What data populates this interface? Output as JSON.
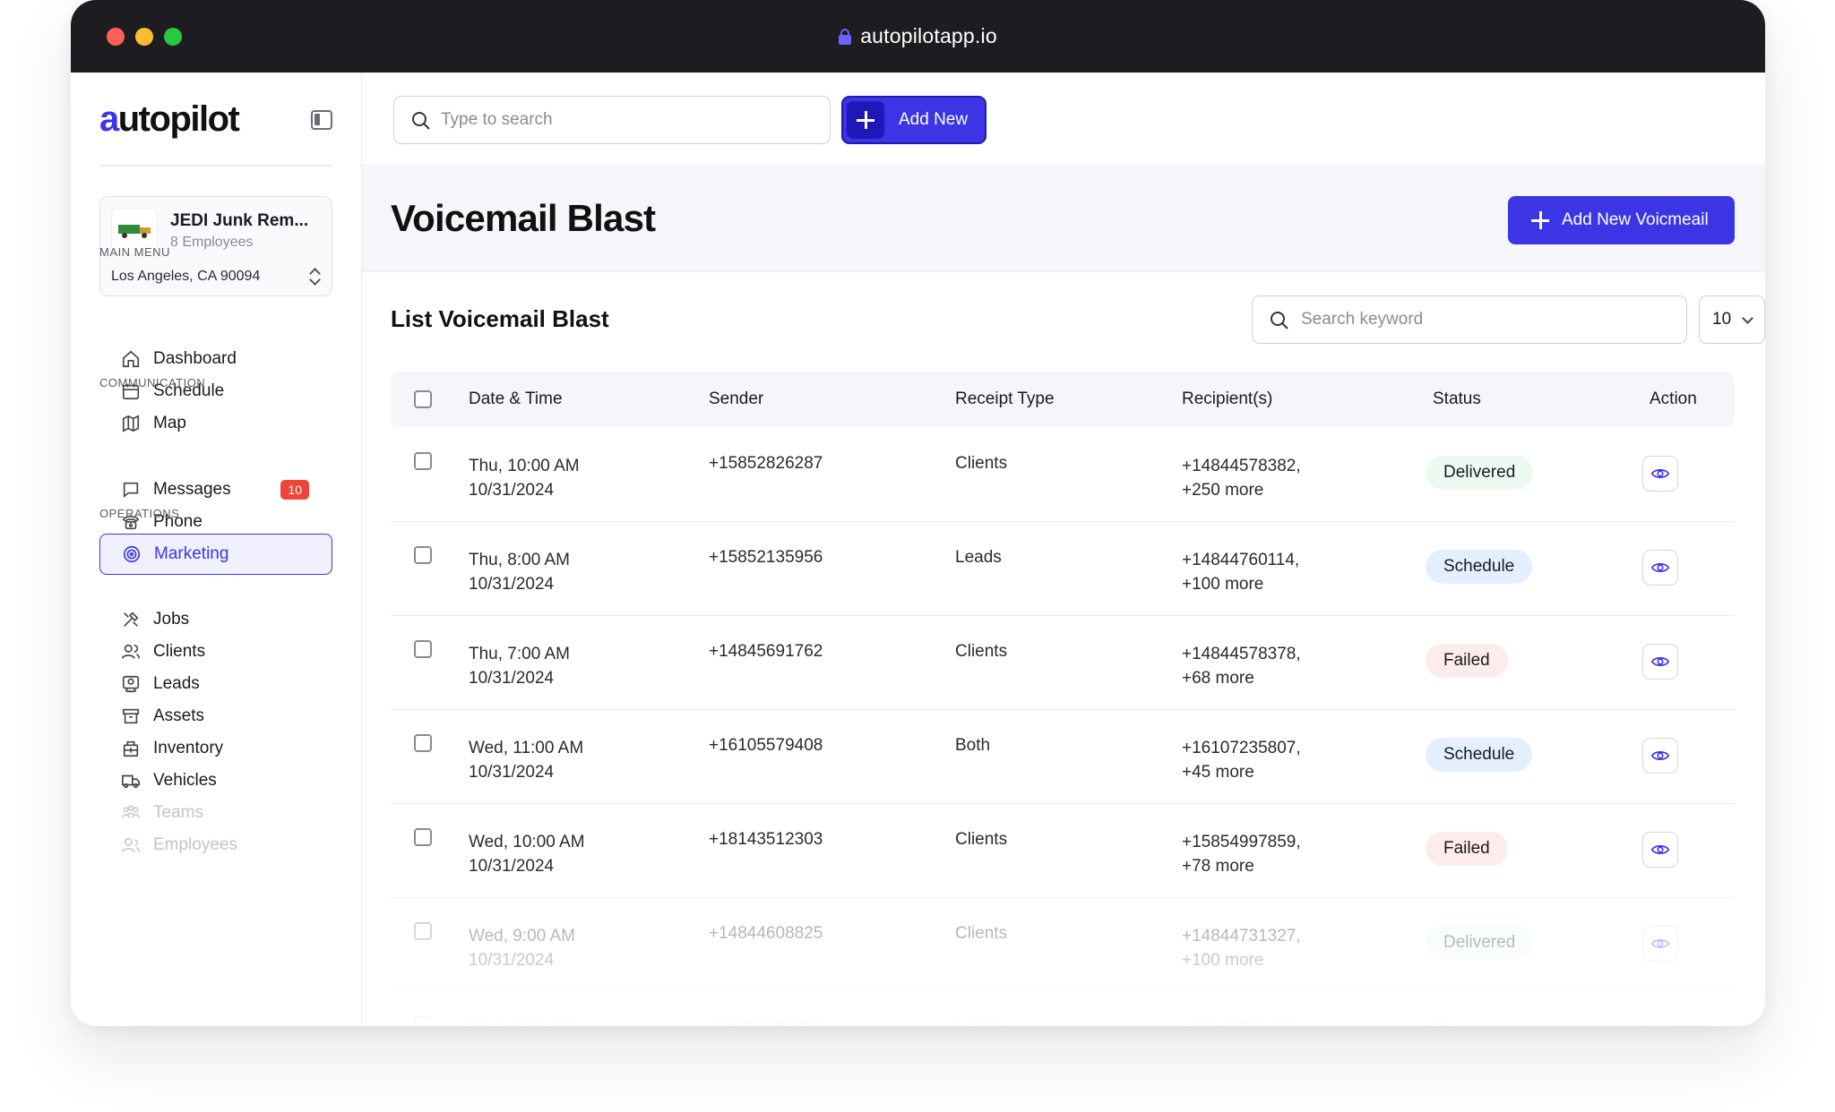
{
  "browser": {
    "url": "autopilotapp.io"
  },
  "logo": {
    "text_a": "a",
    "text_rest": "utopilot"
  },
  "company": {
    "name": "JEDI Junk Rem...",
    "employees": "8 Employees",
    "location": "Los Angeles, CA 90094"
  },
  "sidebar": {
    "sections": {
      "main": "MAIN MENU",
      "communication": "COMMUNICATION",
      "operations": "OPERATIONS"
    },
    "main_items": [
      {
        "label": "Dashboard",
        "icon": "home-icon"
      },
      {
        "label": "Schedule",
        "icon": "calendar-icon"
      },
      {
        "label": "Map",
        "icon": "map-icon"
      }
    ],
    "communication_items": [
      {
        "label": "Messages",
        "icon": "message-icon",
        "badge": "10"
      },
      {
        "label": "Phone",
        "icon": "phone-icon"
      },
      {
        "label": "Marketing",
        "icon": "target-icon",
        "active": true
      }
    ],
    "operations_items": [
      {
        "label": "Jobs",
        "icon": "tools-icon"
      },
      {
        "label": "Clients",
        "icon": "users-icon"
      },
      {
        "label": "Leads",
        "icon": "leads-icon"
      },
      {
        "label": "Assets",
        "icon": "archive-icon"
      },
      {
        "label": "Inventory",
        "icon": "inventory-icon"
      },
      {
        "label": "Vehicles",
        "icon": "truck-icon"
      },
      {
        "label": "Teams",
        "icon": "team-icon"
      },
      {
        "label": "Employees",
        "icon": "employees-icon"
      }
    ]
  },
  "topbar": {
    "search_placeholder": "Type to search",
    "add_new_label": "Add New"
  },
  "page": {
    "title": "Voicemail Blast",
    "primary_button": "Add New Voicmeail"
  },
  "list": {
    "title": "List Voicemail Blast",
    "search_placeholder": "Search keyword",
    "per_page": "10",
    "columns": [
      "Date & Time",
      "Sender",
      "Receipt Type",
      "Recipient(s)",
      "Status",
      "Action"
    ],
    "rows": [
      {
        "date1": "Thu, 10:00 AM",
        "date2": "10/31/2024",
        "sender": "+15852826287",
        "type": "Clients",
        "rec1": "+14844578382,",
        "rec2": "+250 more",
        "status": "Delivered",
        "status_kind": "delivered"
      },
      {
        "date1": "Thu, 8:00 AM",
        "date2": "10/31/2024",
        "sender": "+15852135956",
        "type": "Leads",
        "rec1": "+14844760114,",
        "rec2": "+100 more",
        "status": "Schedule",
        "status_kind": "schedule"
      },
      {
        "date1": "Thu, 7:00 AM",
        "date2": "10/31/2024",
        "sender": "+14845691762",
        "type": "Clients",
        "rec1": "+14844578378,",
        "rec2": "+68 more",
        "status": "Failed",
        "status_kind": "failed"
      },
      {
        "date1": "Wed, 11:00 AM",
        "date2": "10/31/2024",
        "sender": "+16105579408",
        "type": "Both",
        "rec1": "+16107235807,",
        "rec2": "+45 more",
        "status": "Schedule",
        "status_kind": "schedule"
      },
      {
        "date1": "Wed, 10:00 AM",
        "date2": "10/31/2024",
        "sender": "+18143512303",
        "type": "Clients",
        "rec1": "+15854997859,",
        "rec2": "+78 more",
        "status": "Failed",
        "status_kind": "failed"
      },
      {
        "date1": "Wed, 9:00 AM",
        "date2": "10/31/2024",
        "sender": "+14844608825",
        "type": "Clients",
        "rec1": "+14844731327,",
        "rec2": "+100 more",
        "status": "Delivered",
        "status_kind": "delivered"
      },
      {
        "date1": "Wed, 7:00 AM",
        "date2": "",
        "sender": "+15853161950",
        "type": "Leads",
        "rec1": "+18143511440",
        "rec2": "",
        "status": "",
        "status_kind": "schedule"
      }
    ]
  },
  "colors": {
    "accent": "#3b35e6",
    "titlebar": "#1d1d21",
    "badge": "#f04438"
  }
}
